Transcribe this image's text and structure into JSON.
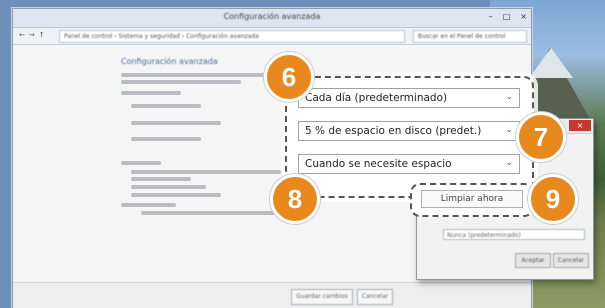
{
  "window": {
    "title": "Configuración avanzada",
    "controls": [
      "–",
      "□",
      "×"
    ],
    "nav": [
      "←",
      "→",
      "↑"
    ],
    "address": "Panel de control › Sistema y seguridad › Configuración avanzada",
    "search_placeholder": "Buscar en el Panel de control"
  },
  "main": {
    "heading": "Configuración avanzada"
  },
  "callout": {
    "combo_when": "Cada día (predeterminado)",
    "combo_space": "5 % de espacio en disco (predet.)",
    "combo_mode": "Cuando se necesite espacio",
    "cleanup_button": "Limpiar ahora"
  },
  "badges": {
    "six": "6",
    "seven": "7",
    "eight": "8",
    "nine": "9"
  },
  "dialog": {
    "close": "×",
    "combo": "Nunca (predeterminado)",
    "ok": "Aceptar",
    "cancel": "Cancelar"
  },
  "footer": {
    "save": "Guardar cambios",
    "cancel": "Cancelar"
  },
  "colors": {
    "badge": "#e8891e",
    "titlebar": "#dde6f0",
    "heading": "#4a6a98"
  }
}
